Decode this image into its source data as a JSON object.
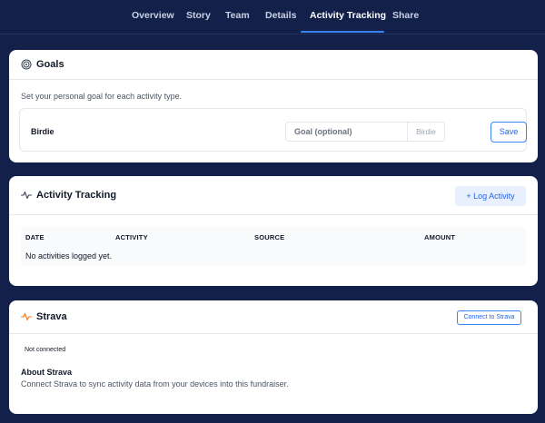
{
  "nav": {
    "tabs": [
      {
        "label": "Overview",
        "active": false
      },
      {
        "label": "Story",
        "active": false
      },
      {
        "label": "Team",
        "active": false
      },
      {
        "label": "Details",
        "active": false
      },
      {
        "label": "Activity Tracking",
        "active": true
      },
      {
        "label": "Share",
        "active": false
      }
    ]
  },
  "goals": {
    "title": "Goals",
    "description": "Set your personal goal for each activity type.",
    "items": [
      {
        "name": "Birdie",
        "value": "",
        "placeholder": "Goal (optional)",
        "unit": "Birdie",
        "save_label": "Save"
      }
    ]
  },
  "activity": {
    "title": "Activity Tracking",
    "log_label": "+ Log Activity",
    "columns": [
      "DATE",
      "ACTIVITY",
      "SOURCE",
      "AMOUNT"
    ],
    "empty_text": "No activities logged yet."
  },
  "strava": {
    "title": "Strava",
    "connect_label": "Connect to Strava",
    "status": "Not connected",
    "about_title": "About Strava",
    "about_text": "Connect Strava to sync activity data from your devices into this fundraiser."
  },
  "colors": {
    "background": "#13204a",
    "accent": "#3b82f6",
    "strava_icon": "#f97316"
  },
  "icons": {
    "goals": "target-icon",
    "activity": "pulse-icon",
    "strava": "strava-pulse-icon"
  }
}
